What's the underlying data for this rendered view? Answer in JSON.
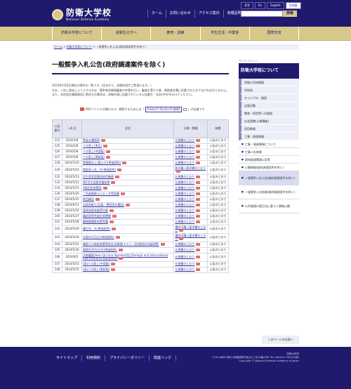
{
  "header": {
    "logo_jp": "防衛大学校",
    "logo_en": "National Defense Academy",
    "nav": [
      "ホーム",
      "お問い合わせ",
      "アクセス案内",
      "各種証明書"
    ],
    "lang": [
      "文字",
      "En",
      "English",
      "日本語"
    ],
    "search_button": "検索"
  },
  "gnav": [
    "防衛大学校について",
    "受験生の方へ",
    "教育・訓練",
    "学生生活・卒業後",
    "国際交流"
  ],
  "breadcrumb": {
    "home": "ホーム",
    "sep1": ">",
    "about": "防衛大学校について",
    "sep2": ">",
    "current": "一般競争入札公告(政府調達案件を除く)"
  },
  "page": {
    "title": "一般競争入札公告(政府調達案件を除く)",
    "intro1": "2024年5月8日現在の案件の一覧です。(品名から、詳細内容がご覧頂けます。)",
    "intro2": "なお、入札に参加しようとする方は、競争参加資格審査の申請を行い、審査を受けた後、資格者名簿に記載された方でなければなりません。",
    "intro3": "また、本校会計課調達班に問合せの場合は、詳細内容に記載されている公告番号・品名(件名)を伝えてください。",
    "pdf_note1": "PDFファイルが開けます。閲覧するためには「",
    "pdf_link": "Adobe® Reader®(無償)",
    "pdf_note2": "」が必要です"
  },
  "table": {
    "headers": [
      "公告番号",
      "入札日",
      "品名",
      "仕様・数量",
      "納期"
    ],
    "rows": [
      [
        "121",
        "2024/5/8",
        "陶芸水槽照明",
        "仕様書のとおり",
        "公告のとおり"
      ],
      [
        "125",
        "2024/5/8",
        "バス版上(黒氏)",
        "仕様書のとおり",
        "公告のとおり"
      ],
      [
        "126",
        "2024/5/8",
        "バス版上(中国製)",
        "仕様書のとおり",
        "公告のとおり"
      ],
      [
        "127",
        "2024/5/8",
        "バス版上(黒新製)",
        "仕様書のとおり",
        "公告のとおり"
      ],
      [
        "128",
        "2024/5/10",
        "警備備品上(富士口)(単価契約)",
        "仕様書のとおり",
        "公告のとおり"
      ],
      [
        "129",
        "2024/5/10",
        "脂肪導入処、外(単価契約)",
        "物品購入要求書のとおり",
        "公告のとおり"
      ],
      [
        "132",
        "2024/5/13",
        "学生食堂設備改修用機器",
        "仕様書のとおり",
        "公告のとおり"
      ],
      [
        "133",
        "2024/5/21",
        "第2学生会館児童給食",
        "仕様書のとおり",
        "公告のとおり"
      ],
      [
        "134",
        "2024/5/15",
        "X線回折装置校",
        "仕様書のとおり",
        "公告のとおり"
      ],
      [
        "136",
        "2024/5/20",
        "「売員電磁ラジエータ等役機",
        "仕様書のとおり",
        "公告のとおり"
      ],
      [
        "137",
        "2024/5/21",
        "物品輸送",
        "仕様書のとおり",
        "公告のとおり"
      ],
      [
        "138",
        "2024/6/11",
        "記録用紙た(足製・整容用の種括)",
        "仕様書のとおり",
        "公告のとおり"
      ],
      [
        "139",
        "2024/5/24",
        "電源溶接装器賃作業",
        "仕様書のとおり",
        "公告のとおり"
      ],
      [
        "140",
        "2024/5/27",
        "構造国等性能定装置機",
        "仕様書のとおり",
        "公告のとおり"
      ],
      [
        "141",
        "2024/5/28",
        "顕微鏡撮影装置等購",
        "仕様書のとおり",
        "公告のとおり"
      ],
      [
        "142",
        "2024/5/29",
        "贈付寺、外(単価契約)",
        "構造品購入要求書のとおり",
        "公告のとおり"
      ],
      [
        "143",
        "2024/5/16",
        "内容外(5月分)(単価契約)",
        "構造品購入要求書のとおり",
        "公告のとおり"
      ],
      [
        "144",
        "2024/5/31",
        "構造ガス取扱装置等保全文庫通(チルニー型(燃焼計別展装置)",
        "仕様書のとおり",
        "公告のとおり"
      ],
      [
        "145",
        "2024/5/30",
        "郵便外(6月分)外(単価契約)",
        "仕様書のとおり",
        "公告のとおり"
      ],
      [
        "146",
        "2024/6/5",
        "文献複製(Hein On Line Standard及びForeign and International Law Resource Database)",
        "仕様書のとおり",
        "公告のとおり"
      ],
      [
        "147",
        "2024/5/15",
        "(高)バス版上(中国製)",
        "仕様書のとおり",
        "公告のとおり"
      ],
      [
        "148",
        "2024/5/15",
        "(高)バス版上(黒新製)",
        "仕様書のとおり",
        "公告のとおり"
      ]
    ]
  },
  "sidebar": {
    "head": "サイドメニュー",
    "title": "防衛大学校について",
    "items": [
      "防衛大学校概要",
      "学校長",
      "キャンパス・施設",
      "広報活動",
      "教育・研究等への取組",
      "社会連携(公開講座)",
      "採用情報",
      "工事・調達情報"
    ],
    "subs": [
      "工事・調達情報について",
      "工事入札結果",
      "政府調達関連公告等",
      "公募情報(政府調達案件を除く)",
      "一般競争入札公告(政府調達案件を除く)",
      "一般競争入札結果(政府調達案件を除く)",
      "公共調達の適正化に基づく情報公開"
    ]
  },
  "pagetop": "このページの先頭へ",
  "footer": {
    "links": [
      "サイトマップ",
      "利用規約",
      "プライバシーポリシー",
      "関連リンク"
    ],
    "org": "防衛大学校",
    "address": "〒239-8686 神奈川県横須賀市走水1丁目10番20号 TEL:046-841-3810(代表)",
    "copyright": "Copyright © National Defense Academy of Japan"
  }
}
